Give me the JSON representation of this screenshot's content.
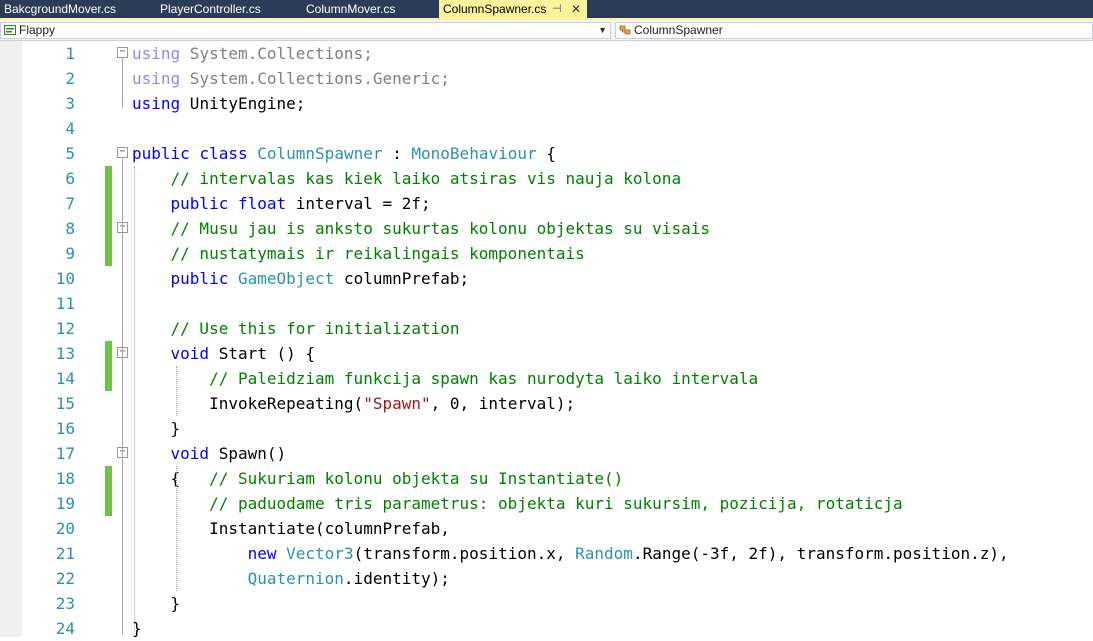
{
  "tabs": [
    {
      "label": "BakcgroundMover.cs",
      "active": false
    },
    {
      "label": "PlayerController.cs",
      "active": false
    },
    {
      "label": "ColumnMover.cs",
      "active": false
    },
    {
      "label": "ColumnSpawner.cs",
      "active": true
    }
  ],
  "active_tab_icons": {
    "pin": "pin-icon",
    "close": "close-icon"
  },
  "nav": {
    "project": "Flappy",
    "type": "ColumnSpawner"
  },
  "colors": {
    "tabbar_bg": "#2b3c59",
    "active_tab_bg": "#fff29d",
    "keyword": "#0000ff",
    "type": "#2b91af",
    "comment": "#008000",
    "string": "#a31515",
    "line_number": "#2b91af",
    "change_marker": "#6cc24a"
  },
  "code": [
    {
      "n": "1",
      "fold": "minus",
      "changed": false,
      "tokens": [
        {
          "t": "using",
          "c": "dimkw"
        },
        {
          "t": " System.Collections;",
          "c": "dim"
        }
      ]
    },
    {
      "n": "2",
      "fold": "",
      "changed": false,
      "tokens": [
        {
          "t": "using",
          "c": "dimkw"
        },
        {
          "t": " System.Collections.Generic;",
          "c": "dim"
        }
      ]
    },
    {
      "n": "3",
      "fold": "",
      "changed": false,
      "tokens": [
        {
          "t": "using",
          "c": "kw"
        },
        {
          "t": " UnityEngine;",
          "c": "plain"
        }
      ]
    },
    {
      "n": "4",
      "fold": "",
      "changed": false,
      "tokens": []
    },
    {
      "n": "5",
      "fold": "minus",
      "changed": false,
      "tokens": [
        {
          "t": "public",
          "c": "kw"
        },
        {
          "t": " ",
          "c": "plain"
        },
        {
          "t": "class",
          "c": "kw"
        },
        {
          "t": " ",
          "c": "plain"
        },
        {
          "t": "ColumnSpawner",
          "c": "type"
        },
        {
          "t": " : ",
          "c": "plain"
        },
        {
          "t": "MonoBehaviour",
          "c": "type"
        },
        {
          "t": " {",
          "c": "plain"
        }
      ]
    },
    {
      "n": "6",
      "fold": "",
      "changed": true,
      "tokens": [
        {
          "t": "    ",
          "c": "plain"
        },
        {
          "t": "// intervalas kas kiek laiko atsiras vis nauja kolona",
          "c": "comment"
        }
      ]
    },
    {
      "n": "7",
      "fold": "",
      "changed": true,
      "tokens": [
        {
          "t": "    ",
          "c": "plain"
        },
        {
          "t": "public",
          "c": "kw"
        },
        {
          "t": " ",
          "c": "plain"
        },
        {
          "t": "float",
          "c": "kw"
        },
        {
          "t": " interval = 2f;",
          "c": "plain"
        }
      ]
    },
    {
      "n": "8",
      "fold": "minus",
      "changed": true,
      "tokens": [
        {
          "t": "    ",
          "c": "plain"
        },
        {
          "t": "// Musu jau is anksto sukurtas kolonu objektas su visais",
          "c": "comment"
        }
      ]
    },
    {
      "n": "9",
      "fold": "",
      "changed": true,
      "tokens": [
        {
          "t": "    ",
          "c": "plain"
        },
        {
          "t": "// nustatymais ir reikalingais komponentais",
          "c": "comment"
        }
      ]
    },
    {
      "n": "10",
      "fold": "",
      "changed": false,
      "tokens": [
        {
          "t": "    ",
          "c": "plain"
        },
        {
          "t": "public",
          "c": "kw"
        },
        {
          "t": " ",
          "c": "plain"
        },
        {
          "t": "GameObject",
          "c": "type"
        },
        {
          "t": " columnPrefab;",
          "c": "plain"
        }
      ]
    },
    {
      "n": "11",
      "fold": "",
      "changed": false,
      "tokens": []
    },
    {
      "n": "12",
      "fold": "",
      "changed": false,
      "tokens": [
        {
          "t": "    ",
          "c": "plain"
        },
        {
          "t": "// Use this for initialization",
          "c": "comment"
        }
      ]
    },
    {
      "n": "13",
      "fold": "minus",
      "changed": true,
      "tokens": [
        {
          "t": "    ",
          "c": "plain"
        },
        {
          "t": "void",
          "c": "kw"
        },
        {
          "t": " Start () {",
          "c": "plain"
        }
      ]
    },
    {
      "n": "14",
      "fold": "",
      "changed": true,
      "tokens": [
        {
          "t": "        ",
          "c": "plain"
        },
        {
          "t": "// Paleidziam funkcija spawn kas nurodyta laiko intervala",
          "c": "comment"
        }
      ]
    },
    {
      "n": "15",
      "fold": "",
      "changed": false,
      "tokens": [
        {
          "t": "        InvokeRepeating(",
          "c": "plain"
        },
        {
          "t": "\"Spawn\"",
          "c": "string"
        },
        {
          "t": ", 0, interval);",
          "c": "plain"
        }
      ]
    },
    {
      "n": "16",
      "fold": "",
      "changed": false,
      "tokens": [
        {
          "t": "    }",
          "c": "plain"
        }
      ]
    },
    {
      "n": "17",
      "fold": "minus",
      "changed": false,
      "tokens": [
        {
          "t": "    ",
          "c": "plain"
        },
        {
          "t": "void",
          "c": "kw"
        },
        {
          "t": " Spawn()",
          "c": "plain"
        }
      ]
    },
    {
      "n": "18",
      "fold": "",
      "changed": true,
      "tokens": [
        {
          "t": "    {   ",
          "c": "plain"
        },
        {
          "t": "// Sukuriam kolonu objekta su Instantiate()",
          "c": "comment"
        }
      ]
    },
    {
      "n": "19",
      "fold": "",
      "changed": true,
      "tokens": [
        {
          "t": "        ",
          "c": "plain"
        },
        {
          "t": "// paduodame tris parametrus: objekta kuri sukursim, pozicija, rotaticja",
          "c": "comment"
        }
      ]
    },
    {
      "n": "20",
      "fold": "",
      "changed": false,
      "tokens": [
        {
          "t": "        Instantiate(columnPrefab,",
          "c": "plain"
        }
      ]
    },
    {
      "n": "21",
      "fold": "",
      "changed": false,
      "tokens": [
        {
          "t": "            ",
          "c": "plain"
        },
        {
          "t": "new",
          "c": "kw"
        },
        {
          "t": " ",
          "c": "plain"
        },
        {
          "t": "Vector3",
          "c": "type"
        },
        {
          "t": "(transform.position.x, ",
          "c": "plain"
        },
        {
          "t": "Random",
          "c": "type"
        },
        {
          "t": ".Range(-3f, 2f), transform.position.z),",
          "c": "plain"
        }
      ]
    },
    {
      "n": "22",
      "fold": "",
      "changed": false,
      "tokens": [
        {
          "t": "            ",
          "c": "plain"
        },
        {
          "t": "Quaternion",
          "c": "type"
        },
        {
          "t": ".identity);",
          "c": "plain"
        }
      ]
    },
    {
      "n": "23",
      "fold": "",
      "changed": false,
      "tokens": [
        {
          "t": "    }",
          "c": "plain"
        }
      ]
    },
    {
      "n": "24",
      "fold": "",
      "changed": false,
      "tokens": [
        {
          "t": "}",
          "c": "plain"
        }
      ]
    }
  ]
}
